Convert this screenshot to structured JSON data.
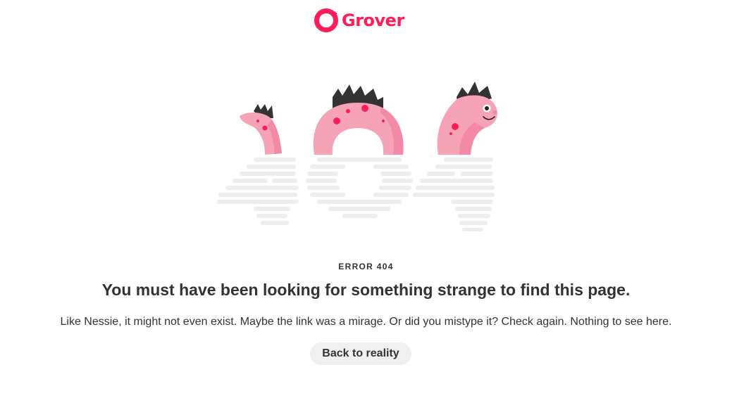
{
  "brand": {
    "name": "Grover",
    "accent_color": "#fe1d58"
  },
  "illustration": {
    "subject": "nessie-404-icon",
    "body_color": "#f6a3b8",
    "spot_color": "#fe1d58",
    "crest_color": "#333333",
    "reflection_color": "#eeeeee"
  },
  "error": {
    "code_label": "ERROR 404",
    "headline": "You must have been looking for something strange to find this page.",
    "message": "Like Nessie, it might not even exist. Maybe the link was a mirage. Or did you mistype it? Check again. Nothing to see here."
  },
  "actions": {
    "back_label": "Back to reality"
  }
}
